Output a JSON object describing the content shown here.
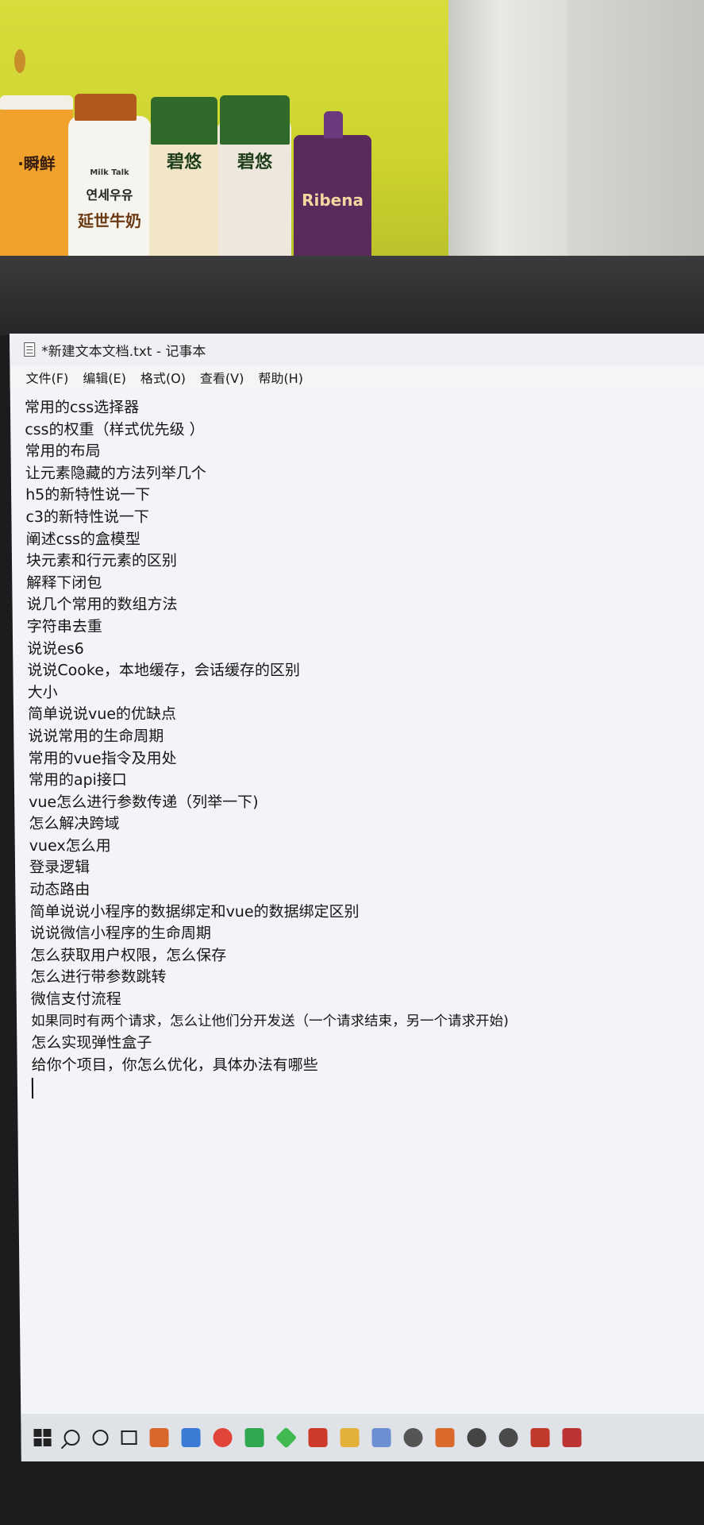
{
  "window": {
    "title": "*新建文本文档.txt - 记事本"
  },
  "menu": [
    {
      "label": "文件(F)"
    },
    {
      "label": "编辑(E)"
    },
    {
      "label": "格式(O)"
    },
    {
      "label": "查看(V)"
    },
    {
      "label": "帮助(H)"
    }
  ],
  "editor": {
    "lines": [
      "常用的css选择器",
      "css的权重（样式优先级 ）",
      "常用的布局",
      "让元素隐藏的方法列举几个",
      "h5的新特性说一下",
      "c3的新特性说一下",
      "阐述css的盒模型",
      "块元素和行元素的区别",
      "解释下闭包",
      "说几个常用的数组方法",
      "字符串去重",
      "说说es6",
      "说说Cooke，本地缓存，会话缓存的区别",
      "大小",
      "简单说说vue的优缺点",
      "说说常用的生命周期",
      "常用的vue指令及用处",
      "常用的api接口",
      "vue怎么进行参数传递（列举一下)",
      "怎么解决跨域",
      "vuex怎么用",
      "登录逻辑",
      "动态路由",
      "简单说说小程序的数据绑定和vue的数据绑定区别",
      "说说微信小程序的生命周期",
      "怎么获取用户权限，怎么保存",
      "怎么进行带参数跳转",
      "微信支付流程",
      "如果同时有两个请求，怎么让他们分开发送（一个请求结束，另一个请求开始)",
      "怎么实现弹性盒子",
      "给你个项目，你怎么优化，具体办法有哪些"
    ]
  },
  "background_labels": {
    "bottle1": "·瞬鲜",
    "bottle2_brand": "Milk Talk",
    "bottle2_kr": "연세우유",
    "bottle2_cn": "延世牛奶",
    "bottle3": "碧悠",
    "bottle4": "碧悠",
    "bottle5": "Ribena"
  },
  "colors": {
    "notepad_bg": "#f2f4f7",
    "text": "#161616",
    "poster_yellow": "#cdd42f"
  }
}
